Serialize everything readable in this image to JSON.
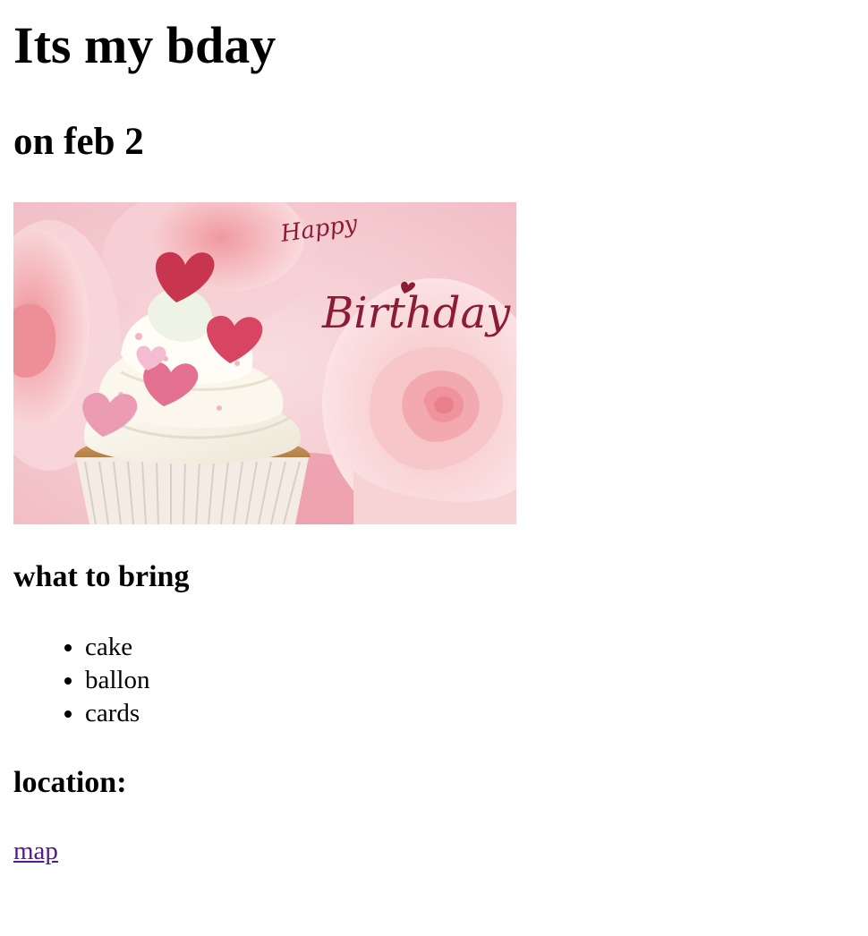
{
  "page": {
    "title": "Its my bday",
    "date": "on feb 2"
  },
  "photo": {
    "overlay_small": "Happy",
    "overlay_large": "Birthday",
    "colors": {
      "background_pink": "#f3c7cc",
      "rose": "#f4b8bd",
      "frosting": "#f8f1e8",
      "cake": "#c9965b",
      "heart_dark": "#c8354f",
      "heart_light": "#e986a3",
      "script": "#8c1c36"
    }
  },
  "bring": {
    "heading": "what to bring",
    "items": [
      {
        "label": "cake"
      },
      {
        "label": "ballon"
      },
      {
        "label": "cards"
      }
    ]
  },
  "location": {
    "heading": "location:",
    "link_label": "map",
    "link_color": "#551a8b"
  }
}
